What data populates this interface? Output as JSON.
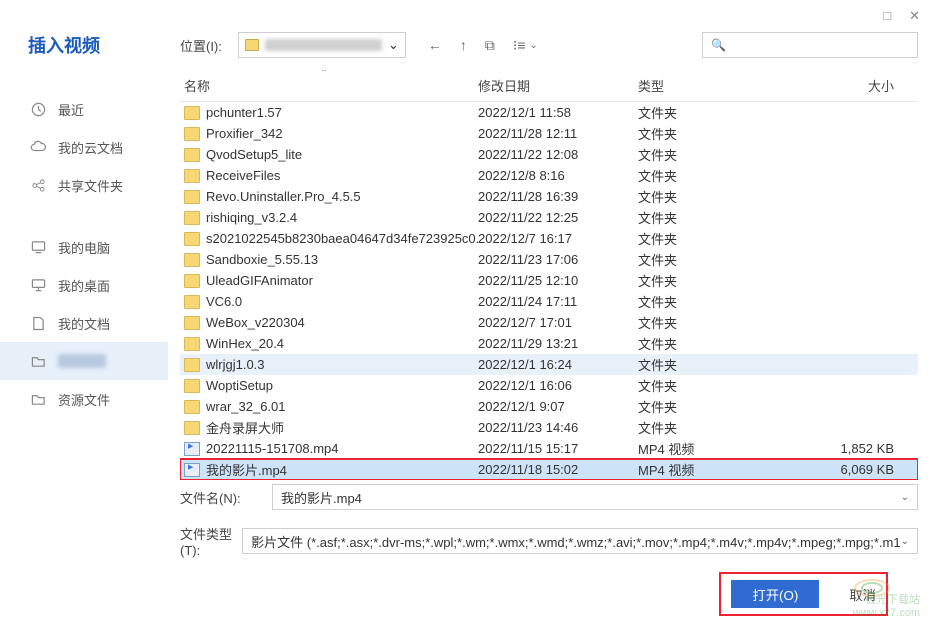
{
  "title": "插入视频",
  "toolbar": {
    "location_label": "位置(I):",
    "dropdown_caret": "⌄"
  },
  "window": {
    "max": "□",
    "close": "✕"
  },
  "nav": {
    "back": "←",
    "up": "↑",
    "new": "⧉",
    "view": "⁝≡",
    "view_caret": "⌄"
  },
  "search": {
    "icon": "🔍"
  },
  "sidebar": {
    "items": [
      {
        "icon": "clock",
        "label": "最近"
      },
      {
        "icon": "cloud",
        "label": "我的云文档"
      },
      {
        "icon": "share",
        "label": "共享文件夹"
      },
      {
        "icon": "pc",
        "label": "我的电脑",
        "gap": true
      },
      {
        "icon": "desktop",
        "label": "我的桌面"
      },
      {
        "icon": "doc",
        "label": "我的文档"
      },
      {
        "icon": "folder",
        "label": "",
        "selected": true
      },
      {
        "icon": "folder",
        "label": "资源文件"
      }
    ]
  },
  "columns": {
    "name": "名称",
    "date": "修改日期",
    "type": "类型",
    "size": "大小",
    "caret": "⌃"
  },
  "files": [
    {
      "ico": "folder",
      "name": "pchunter1.57",
      "date": "2022/12/1 11:58",
      "type": "文件夹",
      "size": ""
    },
    {
      "ico": "folder",
      "name": "Proxifier_342",
      "date": "2022/11/28 12:11",
      "type": "文件夹",
      "size": ""
    },
    {
      "ico": "folder",
      "name": "QvodSetup5_lite",
      "date": "2022/11/22 12:08",
      "type": "文件夹",
      "size": ""
    },
    {
      "ico": "folder",
      "name": "ReceiveFiles",
      "date": "2022/12/8 8:16",
      "type": "文件夹",
      "size": ""
    },
    {
      "ico": "folder",
      "name": "Revo.Uninstaller.Pro_4.5.5",
      "date": "2022/11/28 16:39",
      "type": "文件夹",
      "size": ""
    },
    {
      "ico": "folder",
      "name": "rishiqing_v3.2.4",
      "date": "2022/11/22 12:25",
      "type": "文件夹",
      "size": ""
    },
    {
      "ico": "folder",
      "name": "s2021022545b8230baea04647d34fe723925c0...",
      "date": "2022/12/7 16:17",
      "type": "文件夹",
      "size": ""
    },
    {
      "ico": "folder",
      "name": "Sandboxie_5.55.13",
      "date": "2022/11/23 17:06",
      "type": "文件夹",
      "size": ""
    },
    {
      "ico": "folder",
      "name": "UleadGIFAnimator",
      "date": "2022/11/25 12:10",
      "type": "文件夹",
      "size": ""
    },
    {
      "ico": "folder",
      "name": "VC6.0",
      "date": "2022/11/24 17:11",
      "type": "文件夹",
      "size": ""
    },
    {
      "ico": "folder",
      "name": "WeBox_v220304",
      "date": "2022/12/7 17:01",
      "type": "文件夹",
      "size": ""
    },
    {
      "ico": "folder",
      "name": "WinHex_20.4",
      "date": "2022/11/29 13:21",
      "type": "文件夹",
      "size": ""
    },
    {
      "ico": "folder",
      "name": "wlrjgj1.0.3",
      "date": "2022/12/1 16:24",
      "type": "文件夹",
      "size": "",
      "hover": true
    },
    {
      "ico": "folder",
      "name": "WoptiSetup",
      "date": "2022/12/1 16:06",
      "type": "文件夹",
      "size": ""
    },
    {
      "ico": "folder",
      "name": "wrar_32_6.01",
      "date": "2022/12/1 9:07",
      "type": "文件夹",
      "size": ""
    },
    {
      "ico": "folder",
      "name": "金舟录屏大师",
      "date": "2022/11/23 14:46",
      "type": "文件夹",
      "size": ""
    },
    {
      "ico": "video",
      "name": "20221115-151708.mp4",
      "date": "2022/11/15 15:17",
      "type": "MP4 视频",
      "size": "1,852 KB"
    },
    {
      "ico": "video",
      "name": "我的影片.mp4",
      "date": "2022/11/18 15:02",
      "type": "MP4 视频",
      "size": "6,069 KB",
      "selected": true,
      "redbox": true
    }
  ],
  "bottom": {
    "filename_label": "文件名(N):",
    "filename_value": "我的影片.mp4",
    "filetype_label": "文件类型(T):",
    "filetype_value": "影片文件 (*.asf;*.asx;*.dvr-ms;*.wpl;*.wm;*.wmx;*.wmd;*.wmz;*.avi;*.mov;*.mp4;*.m4v;*.mp4v;*.mpeg;*.mpg;*.m1",
    "open": "打开(O)",
    "cancel": "取消"
  },
  "watermark": {
    "line1": "极光下载站",
    "line2": "www.xz7.com"
  }
}
